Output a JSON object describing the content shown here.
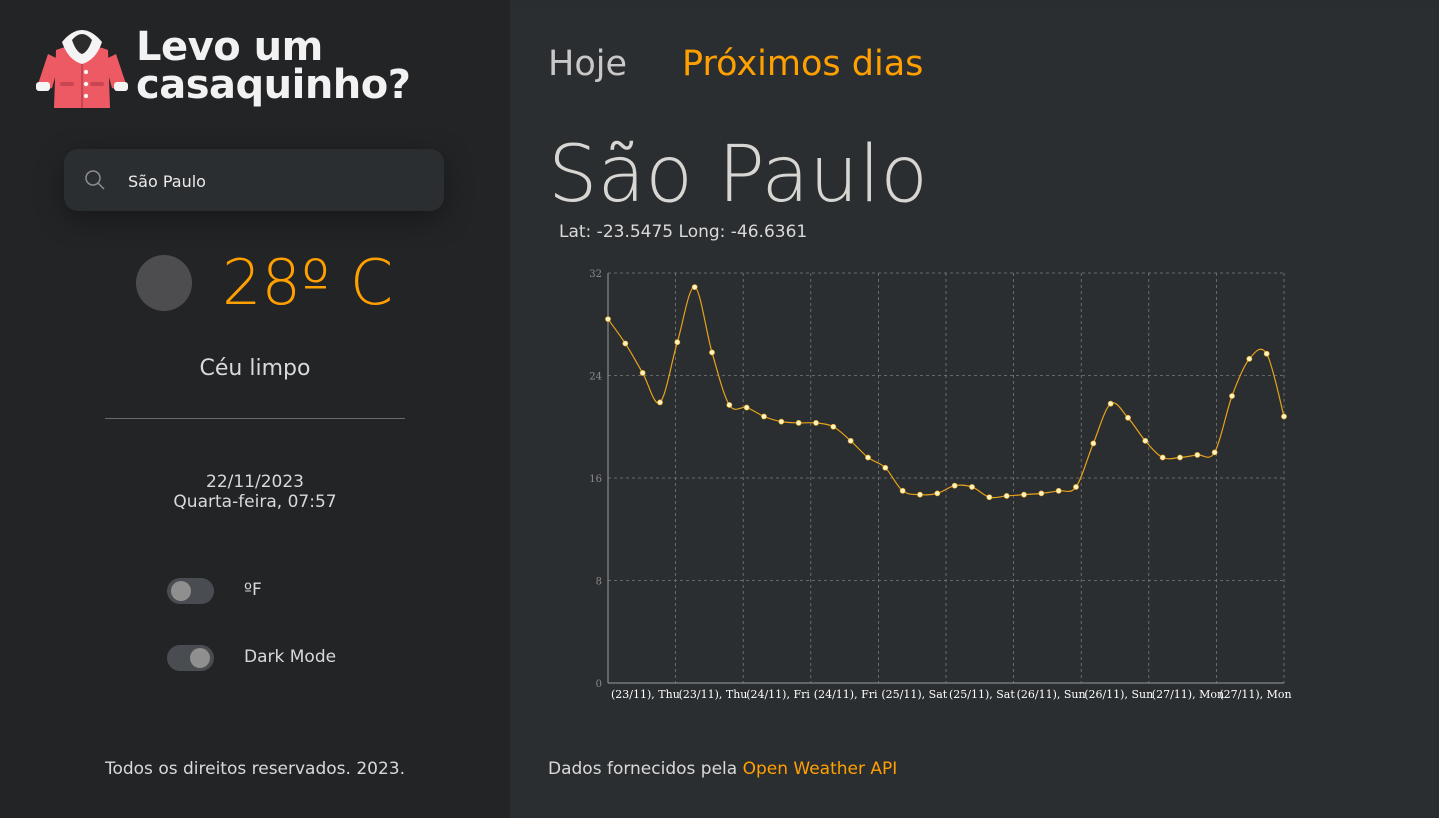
{
  "app": {
    "title_line1": "Levo um",
    "title_line2": "casaquinho?",
    "logo_icon": "coat-icon"
  },
  "search": {
    "value": "São Paulo",
    "icon": "search-icon"
  },
  "current": {
    "temperature": "28º C",
    "description": "Céu limpo",
    "date": "22/11/2023",
    "weekday_time": "Quarta-feira, 07:57"
  },
  "toggles": {
    "fahrenheit_label": "ºF",
    "fahrenheit_on": false,
    "dark_mode_label": "Dark Mode",
    "dark_mode_on": true
  },
  "footer": {
    "copyright": "Todos os direitos reservados. 2023.",
    "data_prefix": "Dados fornecidos pela ",
    "data_link": "Open Weather API"
  },
  "tabs": [
    {
      "label": "Hoje",
      "active": false
    },
    {
      "label": "Próximos dias",
      "active": true
    }
  ],
  "location": {
    "city": "São Paulo",
    "coords": "Lat: -23.5475 Long: -46.6361"
  },
  "colors": {
    "accent": "#ffa000",
    "line": "#e6a21a",
    "point": "#fff3c4"
  },
  "chart_data": {
    "type": "line",
    "title": "",
    "xlabel": "",
    "ylabel": "",
    "ylim": [
      0,
      32
    ],
    "yticks": [
      0,
      8,
      16,
      24,
      32
    ],
    "grid": true,
    "x_tick_labels": [
      "(23/11), Thu",
      "(23/11), Thu",
      "(24/11), Fri",
      "(24/11), Fri",
      "(25/11), Sat",
      "(25/11), Sat",
      "(26/11), Sun",
      "(26/11), Sun",
      "(27/11), Mon",
      "(27/11), Mon"
    ],
    "series": [
      {
        "values": [
          28.4,
          26.5,
          24.2,
          21.9,
          26.6,
          30.9,
          25.8,
          21.7,
          21.5,
          20.8,
          20.4,
          20.3,
          20.3,
          20.0,
          18.9,
          17.6,
          16.8,
          15.0,
          14.7,
          14.8,
          15.4,
          15.3,
          14.5,
          14.6,
          14.7,
          14.8,
          15.0,
          15.3,
          18.7,
          21.8,
          20.7,
          18.9,
          17.6,
          17.6,
          17.8,
          18.0,
          22.4,
          25.3,
          25.7,
          20.8
        ]
      }
    ]
  }
}
